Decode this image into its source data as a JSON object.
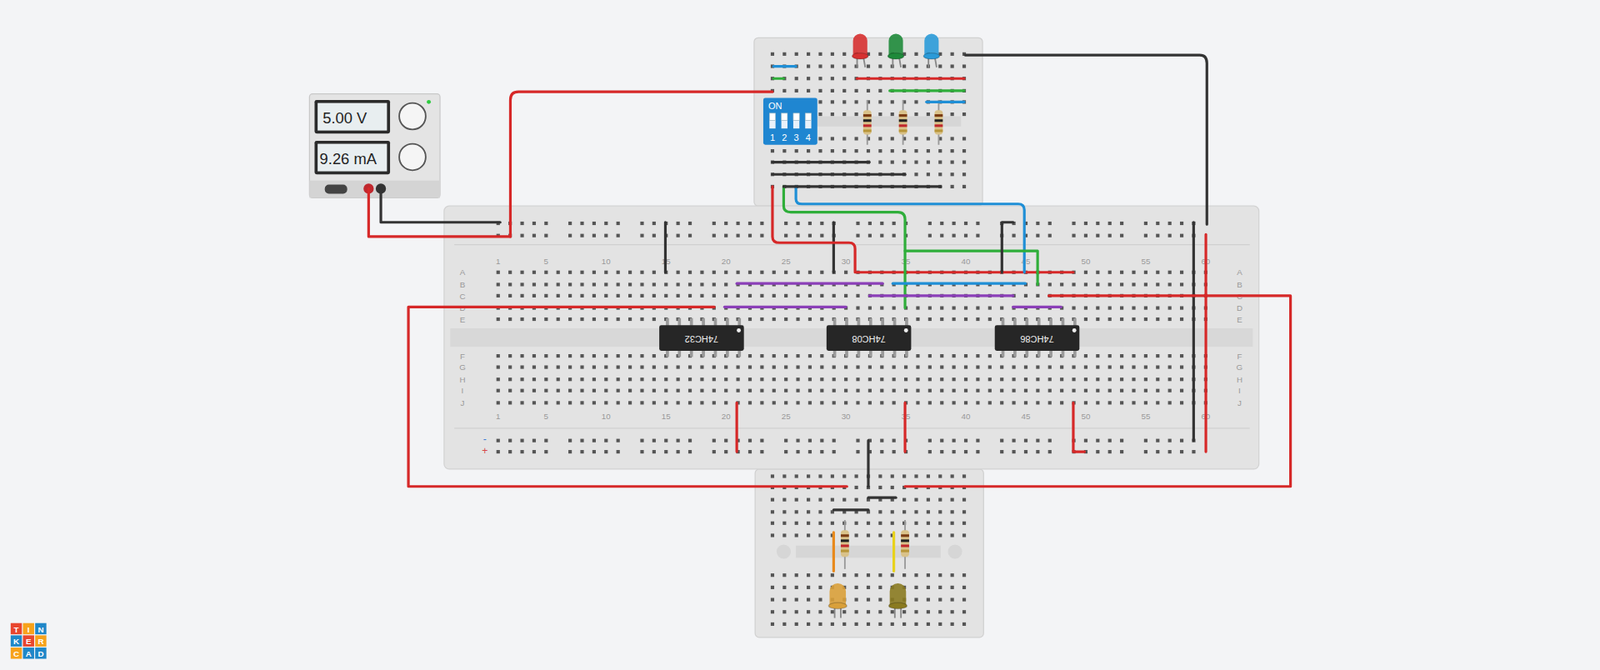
{
  "power_supply": {
    "voltage": "5.00 V",
    "current": "9.26 mA",
    "on": true
  },
  "dip_switch": {
    "label": "ON",
    "switches": [
      {
        "label": "1",
        "on": true
      },
      {
        "label": "2",
        "on": true
      },
      {
        "label": "3",
        "on": true
      },
      {
        "label": "4",
        "on": true
      }
    ]
  },
  "chips": [
    {
      "label": "74HC32"
    },
    {
      "label": "74HC08"
    },
    {
      "label": "74HC86"
    }
  ],
  "breadboard": {
    "columns": [
      "1",
      "5",
      "10",
      "15",
      "20",
      "25",
      "30",
      "35",
      "40",
      "45",
      "50",
      "55",
      "60"
    ],
    "rows_top": [
      "A",
      "B",
      "C",
      "D",
      "E"
    ],
    "rows_bottom": [
      "F",
      "G",
      "H",
      "I",
      "J"
    ],
    "rails": [
      "-",
      "+"
    ]
  },
  "leds_top": [
    {
      "color": "#d63030",
      "lit": false
    },
    {
      "color": "#1e8a3a",
      "lit": false
    },
    {
      "color": "#2a9ad8",
      "lit": false
    }
  ],
  "leds_bottom": [
    {
      "color": "#d9a03a",
      "lit": false
    },
    {
      "color": "#8a7a20",
      "lit": false
    }
  ],
  "logo": [
    {
      "letter": "T",
      "color": "#e8462e"
    },
    {
      "letter": "I",
      "color": "#f7a21b"
    },
    {
      "letter": "N",
      "color": "#1f87c8"
    },
    {
      "letter": "K",
      "color": "#1f87c8"
    },
    {
      "letter": "E",
      "color": "#e8462e"
    },
    {
      "letter": "R",
      "color": "#f7a21b"
    },
    {
      "letter": "C",
      "color": "#f7a21b"
    },
    {
      "letter": "A",
      "color": "#1f87c8"
    },
    {
      "letter": "D",
      "color": "#1f87c8"
    }
  ]
}
